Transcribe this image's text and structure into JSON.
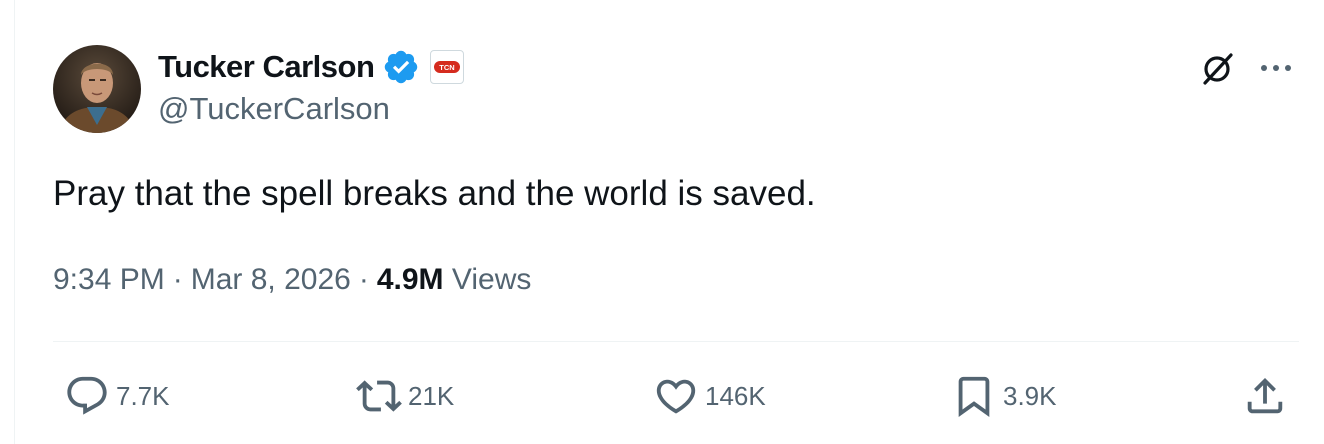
{
  "author": {
    "display_name": "Tucker Carlson",
    "handle": "@TuckerCarlson",
    "verified": true,
    "affiliate_badge": "TCN",
    "verified_color": "#1d9bf0"
  },
  "tweet": {
    "text": "Pray that the spell breaks and the world is saved.",
    "time": "9:34 PM",
    "date": "Mar 8, 2026",
    "views_count": "4.9M",
    "views_label": "Views",
    "separator": "·"
  },
  "actions": {
    "replies": "7.7K",
    "reposts": "21K",
    "likes": "146K",
    "bookmarks": "3.9K"
  },
  "icons": {
    "reply": "speech-bubble-icon",
    "repost": "repost-arrows-icon",
    "like": "heart-icon",
    "bookmark": "bookmark-icon",
    "share": "share-upload-icon",
    "grok": "grok-icon",
    "more": "ellipsis-icon"
  },
  "colors": {
    "text": "#0f1419",
    "secondary": "#536471",
    "divider": "#eff3f4",
    "badge_red": "#d52b1e"
  }
}
